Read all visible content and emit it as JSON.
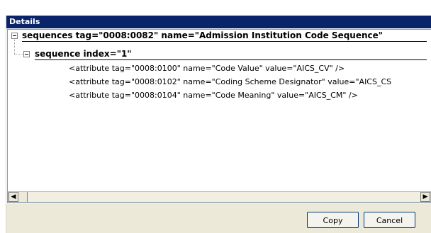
{
  "window": {
    "title": "Details"
  },
  "tree": {
    "root": {
      "label": "sequences tag=\"0008:0082\" name=\"Admission Institution Code Sequence\""
    },
    "child": {
      "label": "sequence index=\"1\""
    },
    "attributes": [
      "<attribute tag=\"0008:0100\" name=\"Code Value\" value=\"AICS_CV\" />",
      "<attribute tag=\"0008:0102\" name=\"Coding Scheme Designator\" value=\"AICS_CS",
      "<attribute tag=\"0008:0104\" name=\"Code Meaning\" value=\"AICS_CM\" />"
    ]
  },
  "scrollbar": {
    "left_arrow": "◀",
    "right_arrow": "▶"
  },
  "buttons": {
    "copy": "Copy",
    "cancel": "Cancel"
  },
  "colors": {
    "title_bar": "#0a246a",
    "panel_bg": "#ece9d8"
  }
}
